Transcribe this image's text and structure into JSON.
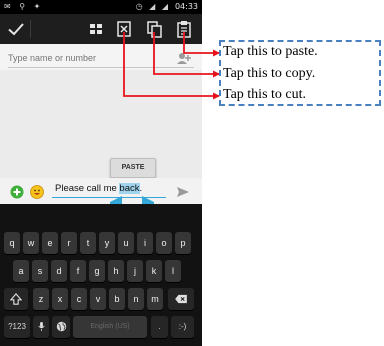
{
  "status_bar": {
    "time": "04:33"
  },
  "to_field": {
    "placeholder": "Type name or number"
  },
  "paste_popup": {
    "label": "PASTE"
  },
  "compose": {
    "text_before": "Please call me ",
    "text_selected": "back",
    "text_after": "."
  },
  "keyboard": {
    "row1": [
      "q",
      "w",
      "e",
      "r",
      "t",
      "y",
      "u",
      "i",
      "o",
      "p"
    ],
    "row2": [
      "a",
      "s",
      "d",
      "f",
      "g",
      "h",
      "j",
      "k",
      "l"
    ],
    "row3": [
      "z",
      "x",
      "c",
      "v",
      "b",
      "n",
      "m"
    ],
    "symbols_key": "?123",
    "space_label": "English (US)",
    "period_key": ".",
    "enter_key": ":-)"
  },
  "callouts": {
    "paste": "Tap this to paste.",
    "copy": "Tap this to copy.",
    "cut": "Tap this to cut."
  },
  "colors": {
    "arrow": "#e8141c",
    "callout_border": "#4a7fc0",
    "selection": "#9fd3ee",
    "handle": "#33a7d8",
    "add_button": "#3fae3a"
  }
}
